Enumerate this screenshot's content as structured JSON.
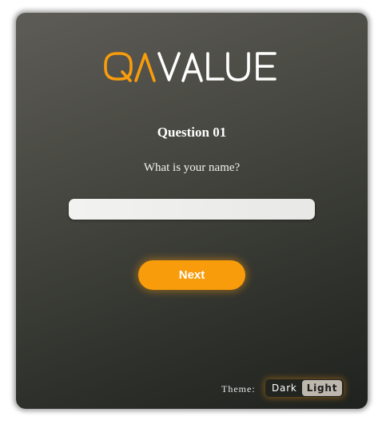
{
  "brand": {
    "logo_text": "QAVALUE",
    "accent_color": "#f99c0b",
    "text_color": "#ffffff"
  },
  "question": {
    "title": "Question 01",
    "prompt": "What is your name?",
    "answer_value": ""
  },
  "actions": {
    "next_label": "Next"
  },
  "theme": {
    "label": "Theme:",
    "options": [
      "Dark",
      "Light"
    ],
    "selected": "Light"
  }
}
